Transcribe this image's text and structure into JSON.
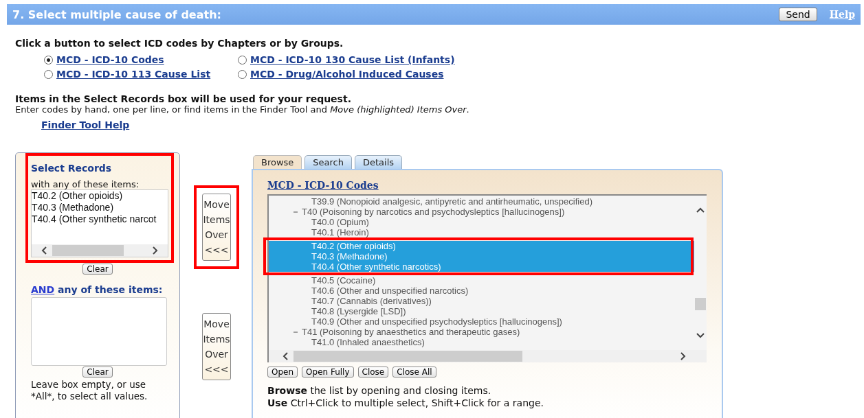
{
  "header": {
    "title": "7. Select multiple cause of death:",
    "send_button": "Send",
    "help_link": "Help"
  },
  "instructions": "Click a button to select ICD codes by Chapters or by Groups.",
  "radios": [
    {
      "label": "MCD - ICD-10 Codes",
      "selected": true
    },
    {
      "label": "MCD - ICD-10 130 Cause List (Infants)",
      "selected": false
    },
    {
      "label": "MCD - ICD-10 113 Cause List",
      "selected": false
    },
    {
      "label": "MCD - Drug/Alcohol Induced Causes",
      "selected": false
    }
  ],
  "notice": {
    "heading": "Items in the Select Records box will be used for your request.",
    "body": "Enter codes by hand, one per line, or find items in the Finder Tool and *Move (highlighted) Items Over*.",
    "help_link": "Finder Tool Help"
  },
  "select_records": {
    "title": "Select Records",
    "subtitle": "with any of these items:",
    "items": [
      "T40.2 (Other opioids)",
      "T40.3 (Methadone)",
      "T40.4 (Other synthetic narcot"
    ],
    "clear_button": "Clear",
    "and_link": "AND",
    "and_label": "any of these items:",
    "clear_button_2": "Clear",
    "note": "Leave box empty, or use *All*, to select all values."
  },
  "move_buttons": [
    {
      "lines": [
        "Move",
        "Items",
        "Over",
        "<<<"
      ],
      "highlighted": true
    },
    {
      "lines": [
        "Move",
        "Items",
        "Over",
        "<<<"
      ],
      "highlighted": false
    }
  ],
  "finder": {
    "tabs": [
      {
        "label": "Browse",
        "selected": true
      },
      {
        "label": "Search",
        "selected": false
      },
      {
        "label": "Details",
        "selected": false
      }
    ],
    "title_link": "MCD - ICD-10 Codes",
    "tree": [
      {
        "kind": "leaf",
        "text": "T39.9 (Nonopioid analgesic, antipyretic and antirheumatic, unspecified)",
        "selected": false
      },
      {
        "kind": "group",
        "text": "T40 (Poisoning by narcotics and psychodysleptics [hallucinogens])",
        "expanded": true,
        "selected": false,
        "children": [
          {
            "kind": "leaf",
            "text": "T40.0 (Opium)",
            "selected": false
          },
          {
            "kind": "leaf",
            "text": "T40.1 (Heroin)",
            "selected": false
          },
          {
            "kind": "leaf",
            "text": "T40.2 (Other opioids)",
            "selected": true
          },
          {
            "kind": "leaf",
            "text": "T40.3 (Methadone)",
            "selected": true
          },
          {
            "kind": "leaf",
            "text": "T40.4 (Other synthetic narcotics)",
            "selected": true
          },
          {
            "kind": "leaf",
            "text": "T40.5 (Cocaine)",
            "selected": false
          },
          {
            "kind": "leaf",
            "text": "T40.6 (Other and unspecified narcotics)",
            "selected": false
          },
          {
            "kind": "leaf",
            "text": "T40.7 (Cannabis (derivatives))",
            "selected": false
          },
          {
            "kind": "leaf",
            "text": "T40.8 (Lysergide [LSD])",
            "selected": false
          },
          {
            "kind": "leaf",
            "text": "T40.9 (Other and unspecified psychodysleptics [hallucinogens])",
            "selected": false
          }
        ]
      },
      {
        "kind": "group",
        "text": "T41 (Poisoning by anaesthetics and therapeutic gases)",
        "expanded": true,
        "selected": false,
        "children": [
          {
            "kind": "leaf",
            "text": "T41.0 (Inhaled anaesthetics)",
            "selected": false
          }
        ]
      }
    ],
    "buttons": [
      "Open",
      "Open Fully",
      "Close",
      "Close All"
    ],
    "help_lines": [
      "**Browse** the list by opening and closing items.",
      "**Use** Ctrl+Click to multiple select, Shift+Click for a range."
    ]
  }
}
